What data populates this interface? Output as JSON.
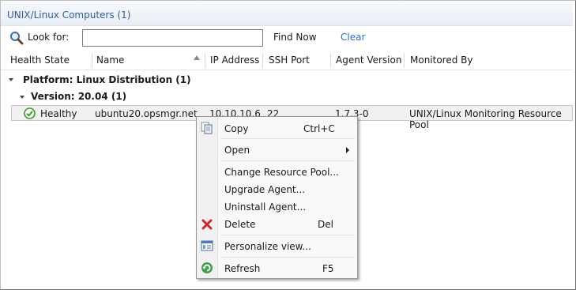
{
  "window": {
    "title": "UNIX/Linux Computers (1)"
  },
  "search": {
    "label": "Look for:",
    "value": "",
    "placeholder": "",
    "find_now": "Find Now",
    "clear": "Clear"
  },
  "columns": [
    "Health State",
    "Name",
    "IP Address",
    "SSH Port",
    "Agent Version",
    "Monitored By"
  ],
  "groups": {
    "platform": "Platform: Linux Distribution (1)",
    "version": "Version: 20.04 (1)"
  },
  "row": {
    "health": "Healthy",
    "name": "ubuntu20.opsmgr.net",
    "ip": "10.10.10.6",
    "ssh": "22",
    "agent_version": "1.7.3-0",
    "monitored_by": "UNIX/Linux Monitoring Resource Pool"
  },
  "context_menu": {
    "copy": "Copy",
    "copy_shortcut": "Ctrl+C",
    "open": "Open",
    "change_pool": "Change Resource Pool...",
    "upgrade": "Upgrade Agent...",
    "uninstall": "Uninstall Agent...",
    "delete": "Delete",
    "delete_shortcut": "Del",
    "personalize": "Personalize view...",
    "refresh": "Refresh",
    "refresh_shortcut": "F5"
  },
  "colors": {
    "title": "#2e5d9a",
    "link": "#2e6fc9",
    "highlight": "#f4f52a",
    "healthy": "#3a9a2a",
    "delete": "#d0262a"
  }
}
